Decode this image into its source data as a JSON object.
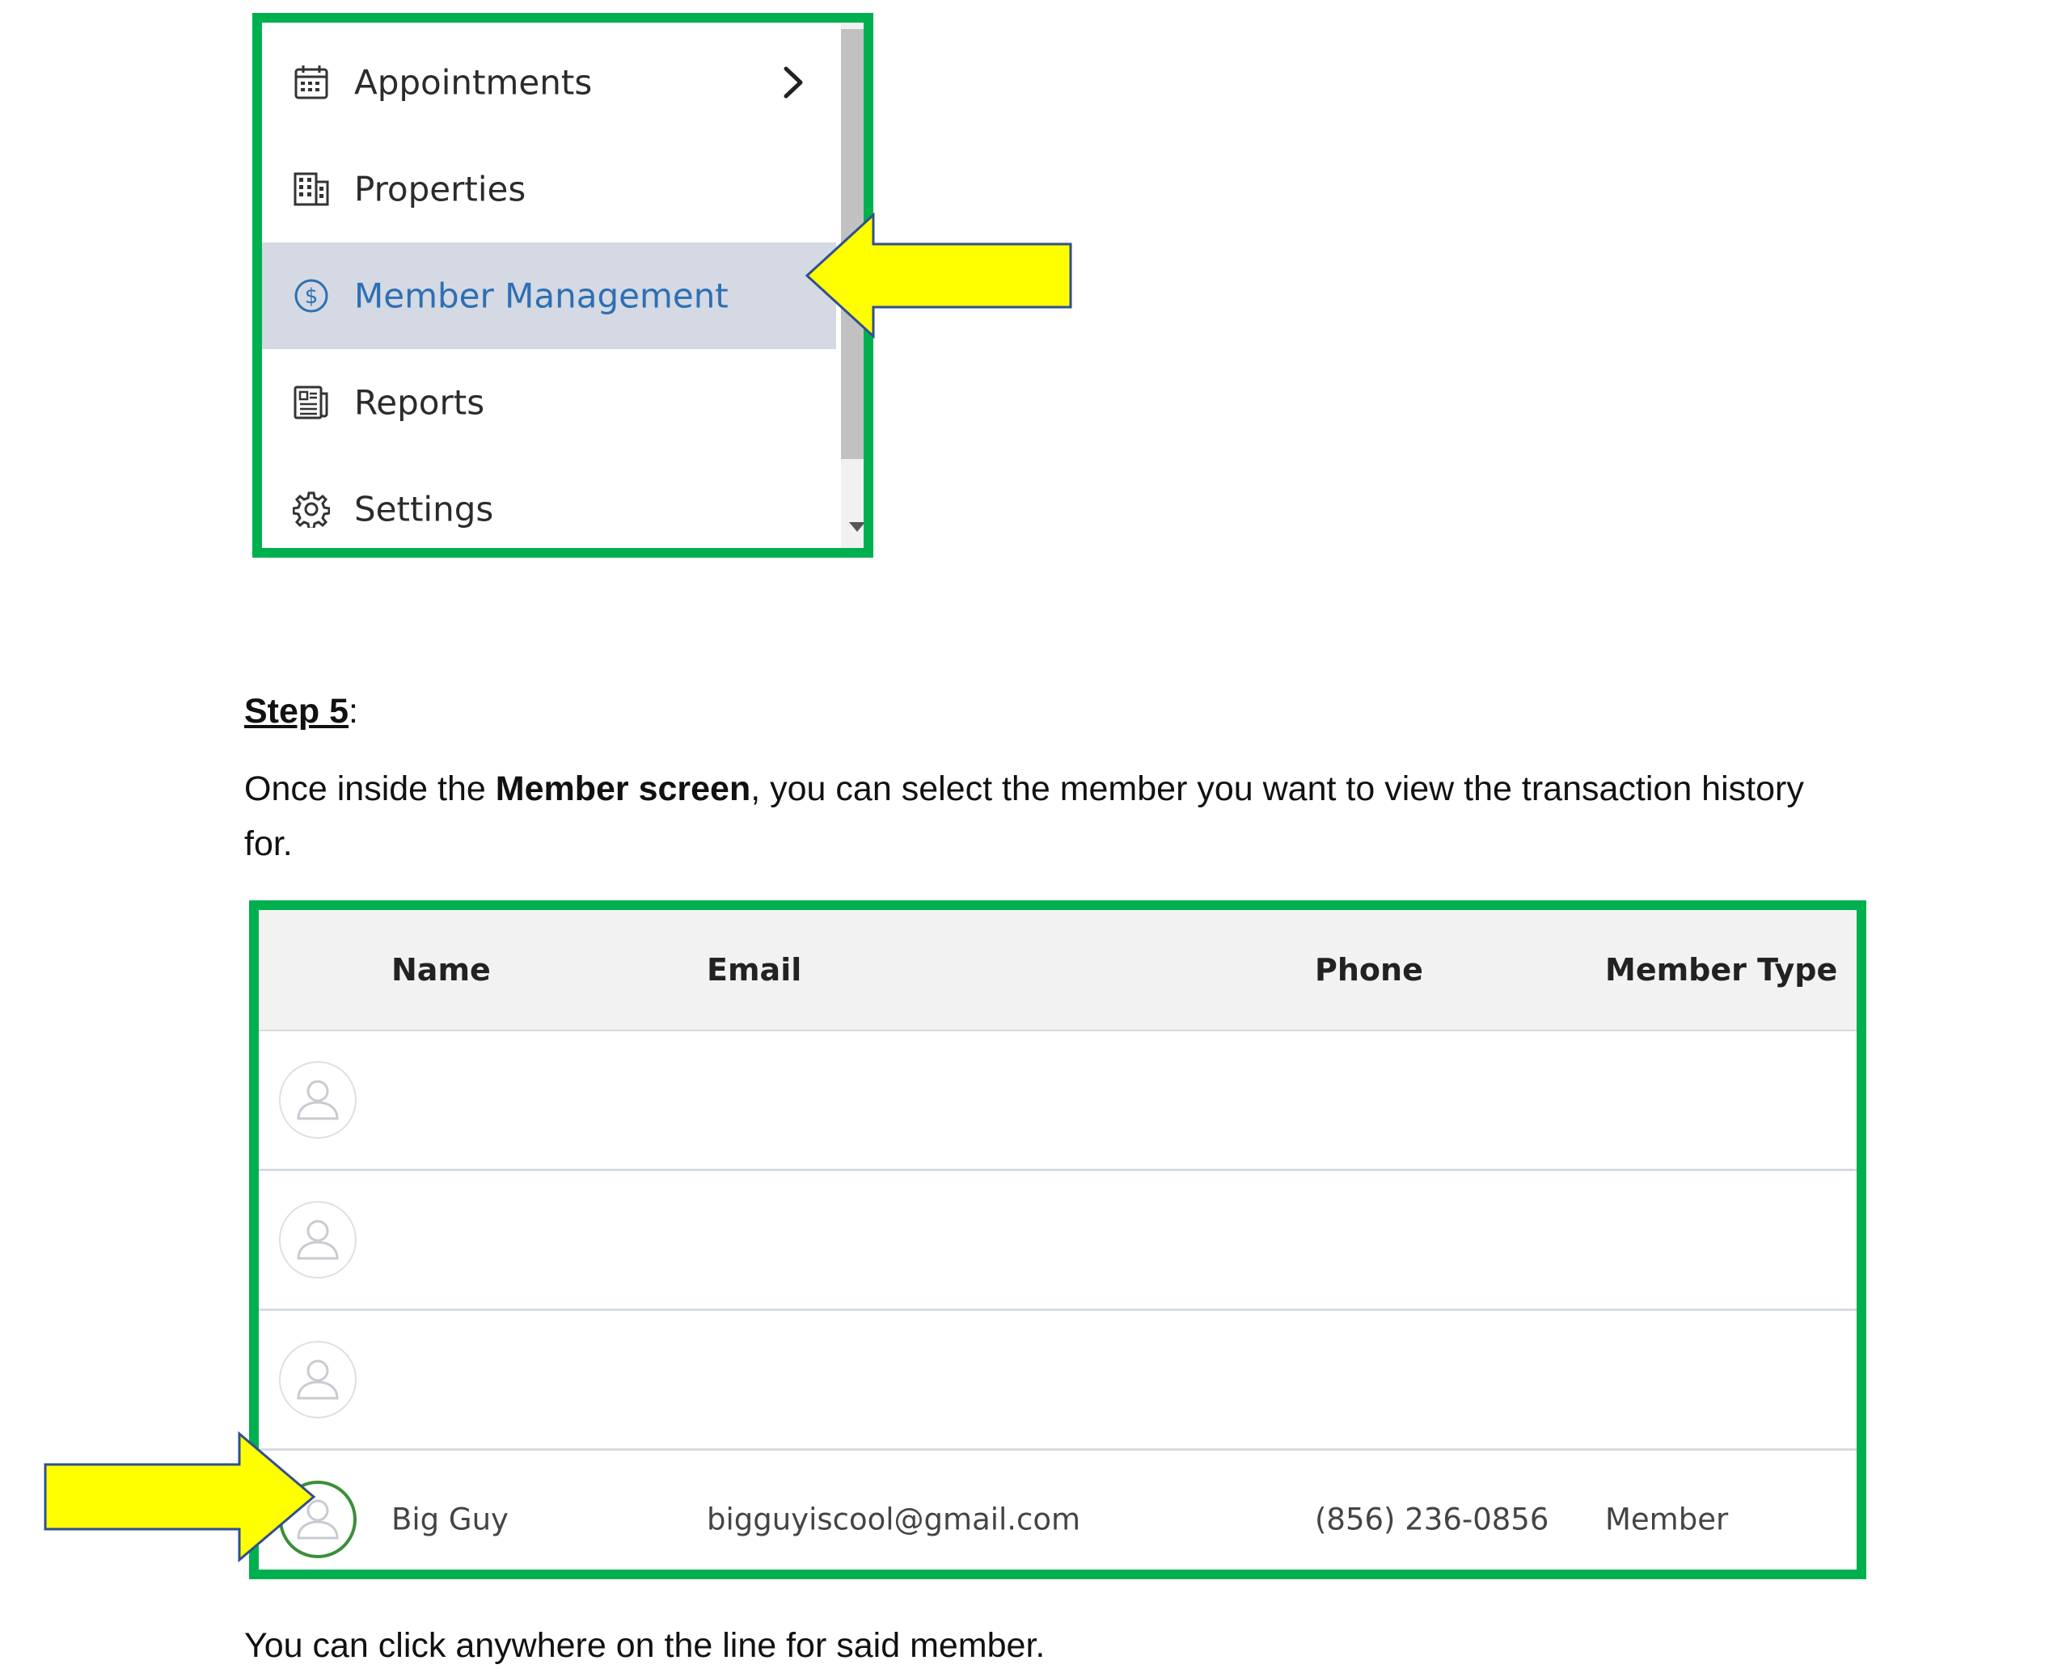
{
  "sidebar": {
    "items": [
      {
        "label": "Appointments",
        "icon": "calendar-icon",
        "has_submenu": true
      },
      {
        "label": "Properties",
        "icon": "building-icon",
        "has_submenu": false
      },
      {
        "label": "Member Management",
        "icon": "dollar-circle-icon",
        "has_submenu": false,
        "active": true
      },
      {
        "label": "Reports",
        "icon": "report-icon",
        "has_submenu": false
      },
      {
        "label": "Settings",
        "icon": "gear-icon",
        "has_submenu": false
      }
    ]
  },
  "step": {
    "heading": "Step 5",
    "colon": ":",
    "intro_before": "Once inside the ",
    "intro_bold": "Member screen",
    "intro_after": ", you can select the member you want to view the transaction history for."
  },
  "table": {
    "columns": [
      "Name",
      "Email",
      "Phone",
      "Member Type"
    ],
    "rows": [
      {
        "name": "",
        "email": "",
        "phone": "",
        "member_type": ""
      },
      {
        "name": "",
        "email": "",
        "phone": "",
        "member_type": ""
      },
      {
        "name": "",
        "email": "",
        "phone": "",
        "member_type": ""
      },
      {
        "name": "Big Guy",
        "email": "bigguyiscool@gmail.com",
        "phone": "(856) 236-0856",
        "member_type": "Member"
      }
    ]
  },
  "footer_note": "You can click anywhere on the line for said member.",
  "colors": {
    "highlight_border": "#00b04f",
    "arrow_fill": "#ffff00",
    "active_item_bg": "#d4d9e3",
    "active_item_text": "#2e6fb4",
    "selected_avatar_ring": "#3a8f3a"
  }
}
